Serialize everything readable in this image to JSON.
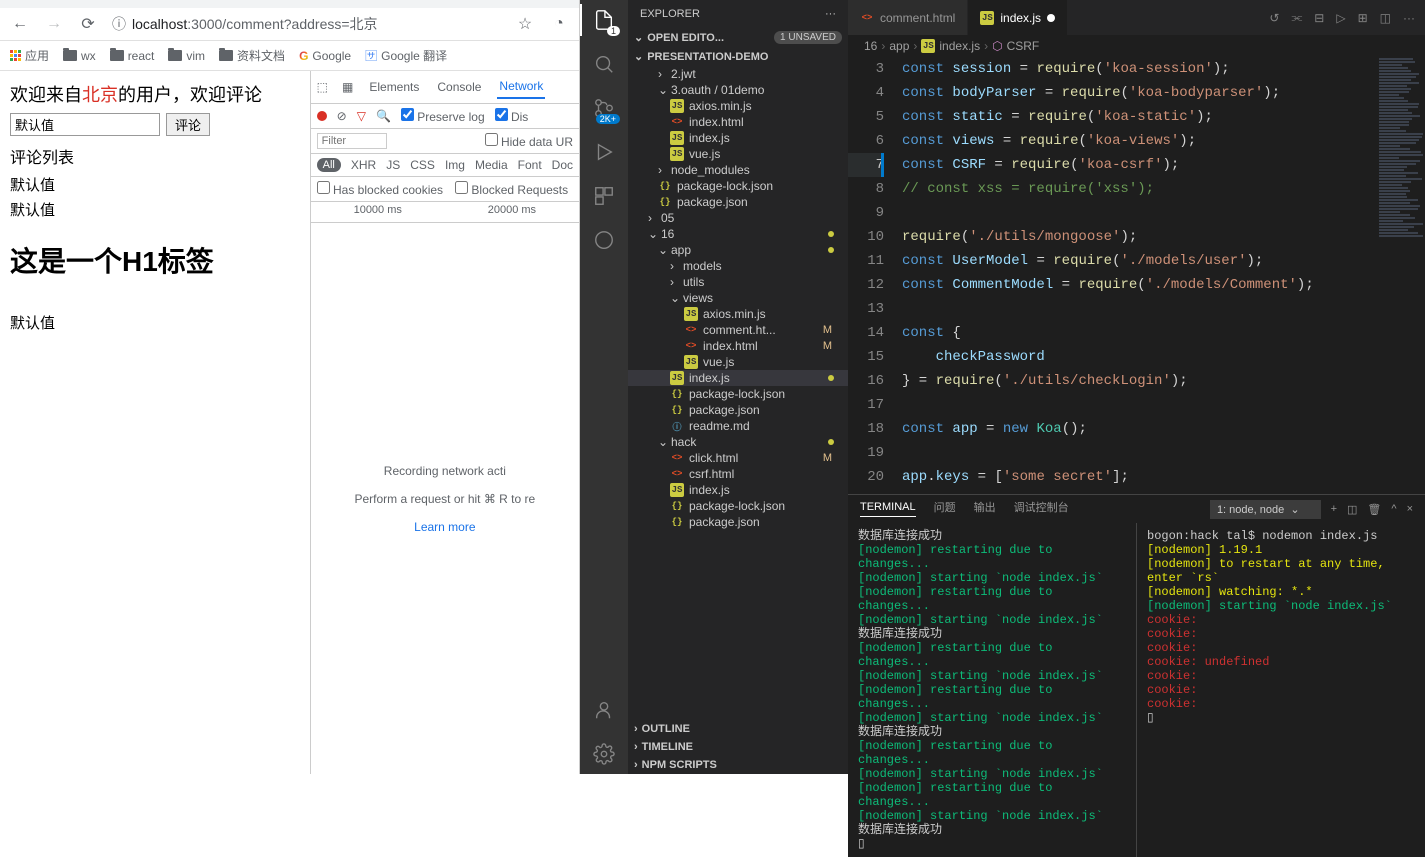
{
  "chrome": {
    "url_full": "localhost:3000/comment?address=北京",
    "bookmarks": [
      "应用",
      "wx",
      "react",
      "vim",
      "资料文档",
      "Google",
      "Google 翻译"
    ],
    "page": {
      "welcome_pre": "欢迎来自",
      "welcome_city": "北京",
      "welcome_post": "的用户，欢迎评论",
      "input_value": "默认值",
      "button_label": "评论",
      "list_title": "评论列表",
      "items": [
        "默认值",
        "默认值"
      ],
      "h1": "这是一个H1标签",
      "footer_item": "默认值"
    },
    "devtools": {
      "tabs": [
        "Elements",
        "Console",
        "Network"
      ],
      "active_tab": 2,
      "preserve_log": "Preserve log",
      "disable_cache": "Dis",
      "filter_placeholder": "Filter",
      "hide_data": "Hide data UR",
      "types": [
        "All",
        "XHR",
        "JS",
        "CSS",
        "Img",
        "Media",
        "Font",
        "Doc"
      ],
      "has_blocked": "Has blocked cookies",
      "blocked_req": "Blocked Requests",
      "timeline": [
        "10000 ms",
        "20000 ms"
      ],
      "recording": "Recording network acti",
      "hint": "Perform a request or hit ⌘ R to re",
      "learn_more": "Learn more"
    }
  },
  "vscode": {
    "explorer_title": "EXPLORER",
    "open_editors": "OPEN EDITO...",
    "unsaved_badge": "1 UNSAVED",
    "project": "PRESENTATION-DEMO",
    "tree": [
      {
        "type": "folder",
        "name": "2.jwt",
        "depth": 1,
        "open": false
      },
      {
        "type": "folder",
        "name": "3.oauth / 01demo",
        "depth": 1,
        "open": true
      },
      {
        "type": "file",
        "name": "axios.min.js",
        "depth": 2,
        "icon": "js"
      },
      {
        "type": "file",
        "name": "index.html",
        "depth": 2,
        "icon": "html"
      },
      {
        "type": "file",
        "name": "index.js",
        "depth": 2,
        "icon": "js"
      },
      {
        "type": "file",
        "name": "vue.js",
        "depth": 2,
        "icon": "js"
      },
      {
        "type": "folder",
        "name": "node_modules",
        "depth": 1,
        "open": false
      },
      {
        "type": "file",
        "name": "package-lock.json",
        "depth": 1,
        "icon": "json"
      },
      {
        "type": "file",
        "name": "package.json",
        "depth": 1,
        "icon": "json"
      },
      {
        "type": "folder",
        "name": "05",
        "depth": 0,
        "open": false
      },
      {
        "type": "folder",
        "name": "16",
        "depth": 0,
        "open": true,
        "dot": true
      },
      {
        "type": "folder",
        "name": "app",
        "depth": 1,
        "open": true,
        "dot": true
      },
      {
        "type": "folder",
        "name": "models",
        "depth": 2,
        "open": false
      },
      {
        "type": "folder",
        "name": "utils",
        "depth": 2,
        "open": false
      },
      {
        "type": "folder",
        "name": "views",
        "depth": 2,
        "open": true
      },
      {
        "type": "file",
        "name": "axios.min.js",
        "depth": 3,
        "icon": "js"
      },
      {
        "type": "file",
        "name": "comment.ht...",
        "depth": 3,
        "icon": "html",
        "status": "M"
      },
      {
        "type": "file",
        "name": "index.html",
        "depth": 3,
        "icon": "html",
        "status": "M"
      },
      {
        "type": "file",
        "name": "vue.js",
        "depth": 3,
        "icon": "js"
      },
      {
        "type": "file",
        "name": "index.js",
        "depth": 2,
        "icon": "js",
        "selected": true,
        "dot": true
      },
      {
        "type": "file",
        "name": "package-lock.json",
        "depth": 2,
        "icon": "json"
      },
      {
        "type": "file",
        "name": "package.json",
        "depth": 2,
        "icon": "json"
      },
      {
        "type": "file",
        "name": "readme.md",
        "depth": 2,
        "icon": "info"
      },
      {
        "type": "folder",
        "name": "hack",
        "depth": 1,
        "open": true,
        "dot": true
      },
      {
        "type": "file",
        "name": "click.html",
        "depth": 2,
        "icon": "html",
        "status": "M"
      },
      {
        "type": "file",
        "name": "csrf.html",
        "depth": 2,
        "icon": "html"
      },
      {
        "type": "file",
        "name": "index.js",
        "depth": 2,
        "icon": "js"
      },
      {
        "type": "file",
        "name": "package-lock.json",
        "depth": 2,
        "icon": "json"
      },
      {
        "type": "file",
        "name": "package.json",
        "depth": 2,
        "icon": "json"
      }
    ],
    "panels": [
      "OUTLINE",
      "TIMELINE",
      "NPM SCRIPTS"
    ],
    "tabs": [
      {
        "name": "comment.html",
        "icon": "html",
        "active": false
      },
      {
        "name": "index.js",
        "icon": "js",
        "active": true,
        "dirty": true
      }
    ],
    "breadcrumbs": [
      "16",
      "app",
      "index.js",
      "CSRF"
    ],
    "code_start_line": 3,
    "code_current_line": 7,
    "code": [
      [
        [
          "kw",
          "const "
        ],
        [
          "var",
          "session"
        ],
        [
          "op",
          " = "
        ],
        [
          "fn",
          "require"
        ],
        [
          "op",
          "("
        ],
        [
          "str",
          "'koa-session'"
        ],
        [
          "op",
          ");"
        ]
      ],
      [
        [
          "kw",
          "const "
        ],
        [
          "var",
          "bodyParser"
        ],
        [
          "op",
          " = "
        ],
        [
          "fn",
          "require"
        ],
        [
          "op",
          "("
        ],
        [
          "str",
          "'koa-bodyparser'"
        ],
        [
          "op",
          ");"
        ]
      ],
      [
        [
          "kw",
          "const "
        ],
        [
          "var",
          "static"
        ],
        [
          "op",
          " = "
        ],
        [
          "fn",
          "require"
        ],
        [
          "op",
          "("
        ],
        [
          "str",
          "'koa-static'"
        ],
        [
          "op",
          ");"
        ]
      ],
      [
        [
          "kw",
          "const "
        ],
        [
          "var",
          "views"
        ],
        [
          "op",
          " = "
        ],
        [
          "fn",
          "require"
        ],
        [
          "op",
          "("
        ],
        [
          "str",
          "'koa-views'"
        ],
        [
          "op",
          ");"
        ]
      ],
      [
        [
          "kw",
          "const "
        ],
        [
          "var",
          "CSRF"
        ],
        [
          "op",
          " = "
        ],
        [
          "fn",
          "require"
        ],
        [
          "op",
          "("
        ],
        [
          "str",
          "'koa-csrf'"
        ],
        [
          "op",
          ");"
        ]
      ],
      [
        [
          "cmt",
          "// const xss = require('xss');"
        ]
      ],
      [],
      [
        [
          "fn",
          "require"
        ],
        [
          "op",
          "("
        ],
        [
          "str",
          "'./utils/mongoose'"
        ],
        [
          "op",
          ");"
        ]
      ],
      [
        [
          "kw",
          "const "
        ],
        [
          "var",
          "UserModel"
        ],
        [
          "op",
          " = "
        ],
        [
          "fn",
          "require"
        ],
        [
          "op",
          "("
        ],
        [
          "str",
          "'./models/user'"
        ],
        [
          "op",
          ");"
        ]
      ],
      [
        [
          "kw",
          "const "
        ],
        [
          "var",
          "CommentModel"
        ],
        [
          "op",
          " = "
        ],
        [
          "fn",
          "require"
        ],
        [
          "op",
          "("
        ],
        [
          "str",
          "'./models/Comment'"
        ],
        [
          "op",
          ");"
        ]
      ],
      [],
      [
        [
          "kw",
          "const "
        ],
        [
          "op",
          "{"
        ]
      ],
      [
        [
          "var",
          "    checkPassword"
        ]
      ],
      [
        [
          "op",
          "} = "
        ],
        [
          "fn",
          "require"
        ],
        [
          "op",
          "("
        ],
        [
          "str",
          "'./utils/checkLogin'"
        ],
        [
          "op",
          ");"
        ]
      ],
      [],
      [
        [
          "kw",
          "const "
        ],
        [
          "var",
          "app"
        ],
        [
          "op",
          " = "
        ],
        [
          "kw",
          "new "
        ],
        [
          "cls",
          "Koa"
        ],
        [
          "op",
          "();"
        ]
      ],
      [],
      [
        [
          "var",
          "app"
        ],
        [
          "op",
          "."
        ],
        [
          "var",
          "keys"
        ],
        [
          "op",
          " = ["
        ],
        [
          "str",
          "'some secret'"
        ],
        [
          "op",
          "];"
        ]
      ],
      []
    ],
    "terminal": {
      "tab": "TERMINAL",
      "tabs_other": [
        "问题",
        "输出",
        "调试控制台"
      ],
      "select": "1: node, node",
      "left": [
        [
          "white",
          "数据库连接成功"
        ],
        [
          "green",
          "[nodemon] restarting due to changes..."
        ],
        [
          "green",
          "[nodemon] starting `node index.js`"
        ],
        [
          "green",
          "[nodemon] restarting due to changes..."
        ],
        [
          "green",
          "[nodemon] starting `node index.js`"
        ],
        [
          "white",
          "数据库连接成功"
        ],
        [
          "green",
          "[nodemon] restarting due to changes..."
        ],
        [
          "green",
          "[nodemon] starting `node index.js`"
        ],
        [
          "green",
          "[nodemon] restarting due to changes..."
        ],
        [
          "green",
          "[nodemon] starting `node index.js`"
        ],
        [
          "white",
          "数据库连接成功"
        ],
        [
          "green",
          "[nodemon] restarting due to changes..."
        ],
        [
          "green",
          "[nodemon] starting `node index.js`"
        ],
        [
          "green",
          "[nodemon] restarting due to changes..."
        ],
        [
          "green",
          "[nodemon] starting `node index.js`"
        ],
        [
          "white",
          "数据库连接成功"
        ],
        [
          "white",
          "▯"
        ]
      ],
      "right": [
        [
          "white",
          "bogon:hack tal$ nodemon index.js"
        ],
        [
          "yellow",
          "[nodemon] 1.19.1"
        ],
        [
          "yellow",
          "[nodemon] to restart at any time, enter `rs`"
        ],
        [
          "yellow",
          "[nodemon] watching: *.*"
        ],
        [
          "green",
          "[nodemon] starting `node index.js`"
        ],
        [
          "red",
          "cookie:"
        ],
        [
          "red",
          "cookie:"
        ],
        [
          "red",
          "cookie:"
        ],
        [
          "red",
          "cookie: undefined"
        ],
        [
          "red",
          "cookie:"
        ],
        [
          "red",
          "cookie:"
        ],
        [
          "red",
          "cookie:"
        ],
        [
          "white",
          "▯"
        ]
      ]
    },
    "scm_badge": "2K+"
  }
}
